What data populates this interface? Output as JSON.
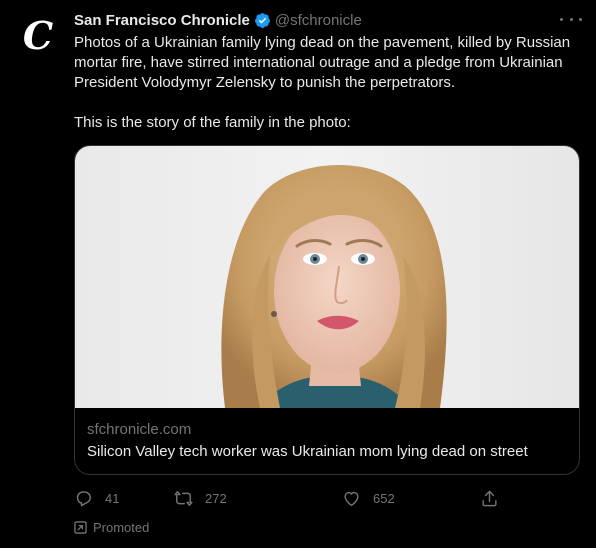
{
  "account": {
    "name": "San Francisco Chronicle",
    "handle": "@sfchronicle",
    "avatar_letter": "C"
  },
  "tweet": {
    "text": "Photos of a Ukrainian family lying dead on the pavement, killed by Russian mortar fire, have stirred international outrage and a pledge from Ukrainian President Volodymyr Zelensky to punish the perpetrators.\n\nThis is the story of the family in the photo:"
  },
  "card": {
    "domain": "sfchronicle.com",
    "title": "Silicon Valley tech worker was Ukrainian mom lying dead on street"
  },
  "actions": {
    "replies": "41",
    "retweets": "272",
    "likes": "652"
  },
  "promoted_label": "Promoted",
  "colors": {
    "background": "#000000",
    "text": "#e7e9ea",
    "secondary": "#71767b",
    "verified": "#1d9bf0",
    "border": "#2f3336"
  },
  "icons": {
    "reply": "reply-icon",
    "retweet": "retweet-icon",
    "like": "heart-icon",
    "share": "share-icon",
    "more": "more-icon",
    "verified": "verified-badge-icon",
    "promoted": "promoted-icon"
  }
}
